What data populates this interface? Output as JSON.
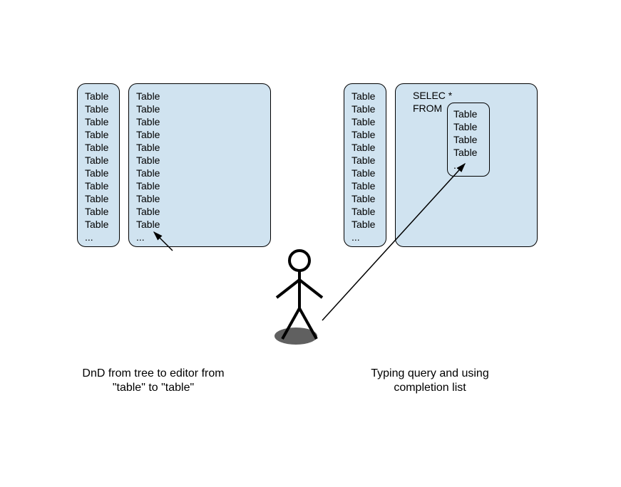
{
  "tableItem": "Table",
  "ellipsis": "...",
  "sqlLine1": "SELEC *",
  "sqlLine2": "FROM",
  "annotations": {
    "leftLine1": "DnD from tree to editor from",
    "leftLine2": "\"table\" to \"table\"",
    "rightLine1": "Typing query and using",
    "rightLine2": "completion list"
  }
}
